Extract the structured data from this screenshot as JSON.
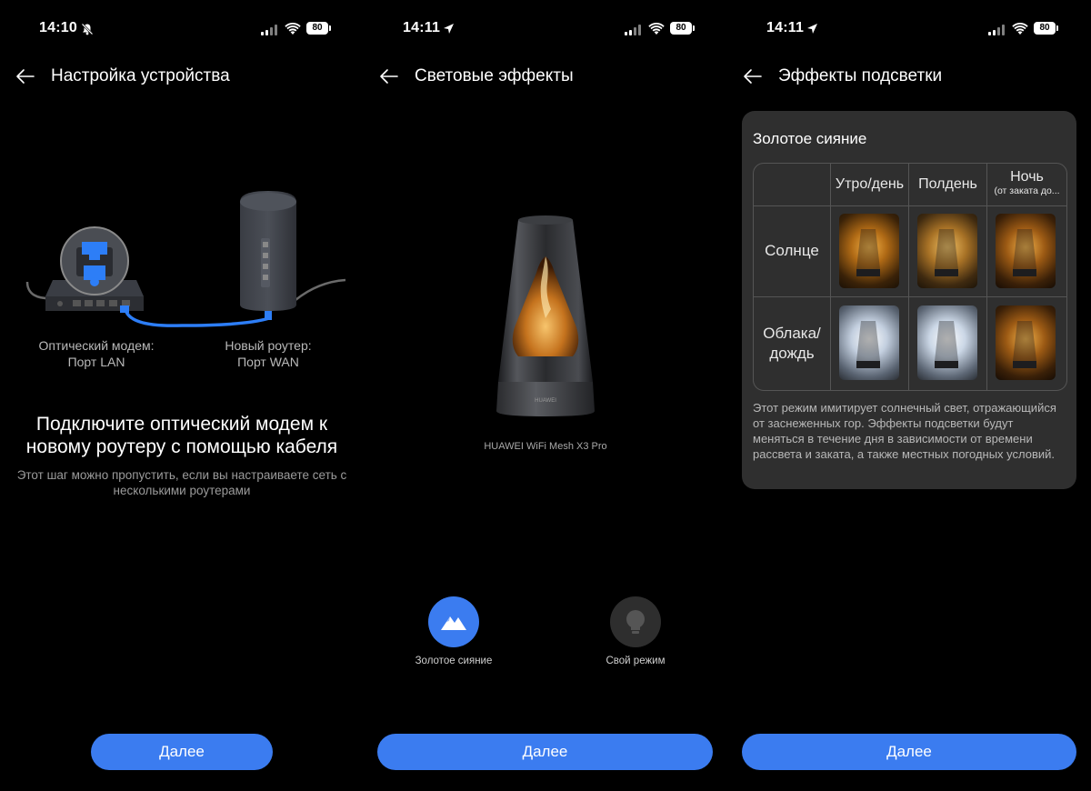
{
  "colors": {
    "accent": "#3b7cf0",
    "background": "#000000",
    "card": "#2f2f2f",
    "muted_text": "#9b9b9b"
  },
  "status_bar": {
    "s1": {
      "time": "14:10",
      "time_icon": "bell-slash-icon",
      "battery": "80"
    },
    "s2": {
      "time": "14:11",
      "time_icon": "location-arrow-icon",
      "battery": "80"
    },
    "s3": {
      "time": "14:11",
      "time_icon": "location-arrow-icon",
      "battery": "80"
    }
  },
  "screen1": {
    "title": "Настройка устройства",
    "modem_label": [
      "Оптический модем:",
      "Порт LAN"
    ],
    "router_label": [
      "Новый роутер:",
      "Порт WAN"
    ],
    "headline": "Подключите оптический модем к новому роутеру с помощью кабеля",
    "subline": "Этот шаг можно пропустить, если вы настраиваете сеть с несколькими роутерами",
    "next_button": "Далее"
  },
  "screen2": {
    "title": "Световые эффекты",
    "product_name": "HUAWEI WiFi Mesh X3 Pro",
    "modes": [
      {
        "label": "Золотое сияние",
        "icon": "mountain-icon",
        "selected": true
      },
      {
        "label": "Свой режим",
        "icon": "lightbulb-icon",
        "selected": false
      }
    ],
    "next_button": "Далее"
  },
  "screen3": {
    "title": "Эффекты подсветки",
    "card_title": "Золотое сияние",
    "columns": [
      "Утро/день",
      "Полдень",
      "Ночь",
      "(от заката до..."
    ],
    "rows": [
      "Солнце",
      [
        "Облака/",
        "дождь"
      ]
    ],
    "description": "Этот режим имитирует солнечный свет, отражающийся от заснеженных гор. Эффекты подсветки будут меняться в течение дня в зависимости от времени рассвета и заката, а также местных погодных условий.",
    "next_button": "Далее"
  }
}
